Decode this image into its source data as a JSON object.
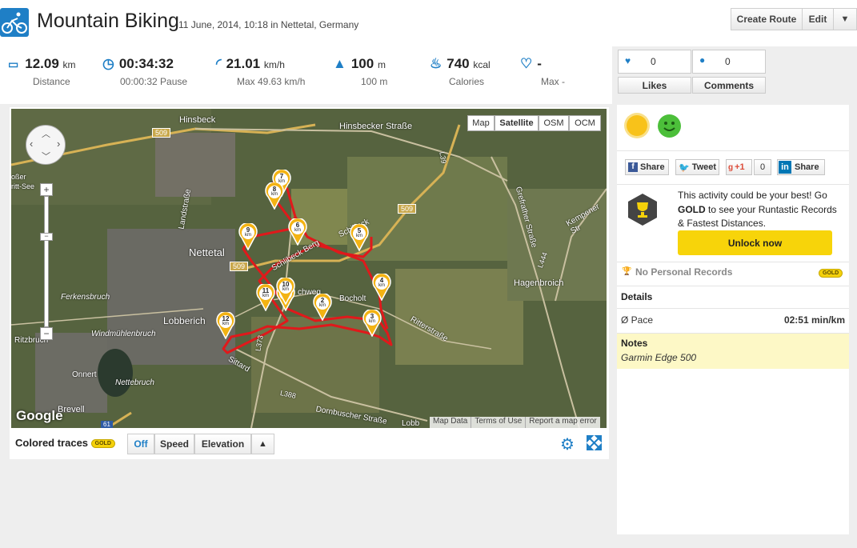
{
  "header": {
    "title": "Mountain Biking",
    "subtitle": "11 June, 2014, 10:18 in Nettetal, Germany",
    "create_route": "Create Route",
    "edit": "Edit"
  },
  "stats": [
    {
      "icon": "ruler-icon",
      "value": "12.09",
      "unit": "km",
      "sub": "Distance"
    },
    {
      "icon": "clock-icon",
      "value": "00:34:32",
      "unit": "",
      "sub": "00:00:32 Pause"
    },
    {
      "icon": "speedometer-icon",
      "value": "21.01",
      "unit": "km/h",
      "sub": "Max 49.63 km/h"
    },
    {
      "icon": "mountain-icon",
      "value": "100",
      "unit": "m",
      "sub": "100 m"
    },
    {
      "icon": "flame-icon",
      "value": "740",
      "unit": "kcal",
      "sub": "Calories"
    },
    {
      "icon": "heart-rate-icon",
      "value": "-",
      "unit": "",
      "sub": "Max -"
    }
  ],
  "social": {
    "likes_count": "0",
    "comments_count": "0",
    "likes_label": "Likes",
    "comments_label": "Comments"
  },
  "map": {
    "types": [
      "Map",
      "Satellite",
      "OSM",
      "OCM"
    ],
    "active_type": "Satellite",
    "labels": {
      "hinsbeck": "Hinsbeck",
      "hinsbecker_strasse": "Hinsbecker Straße",
      "nettetal": "Nettetal",
      "lobberich": "Lobberich",
      "ferkensbruch": "Ferkensbruch",
      "windmuehlenbruch": "Windmühlenbruch",
      "ritzbruch": "Ritzbruch",
      "onnert": "Onnert",
      "nettebruch": "Nettebruch",
      "brevell": "Brevell",
      "hagenbroich": "Hagenbroich",
      "landstrasse": "Landstraße",
      "schibeck": "Schibeck",
      "schlibeck": "Schlibeck Berg",
      "ritterstrasse": "Ritterstraße",
      "sittard": "Sittard",
      "dornbuscher": "Dornbuscher Straße",
      "grefrather": "Grefrather Straße",
      "kempener": "Kempener Str",
      "bocholt": "Bocholt",
      "chweg": "chweg",
      "l39": "L39",
      "l373": "L373",
      "l388": "L388",
      "l444": "L444",
      "road509": "509",
      "road61": "61",
      "obb": "Lobb",
      "grossen": "oßer",
      "witt": "ritt-See"
    },
    "markers": [
      "1",
      "2",
      "3",
      "4",
      "5",
      "6",
      "7",
      "8",
      "9",
      "10",
      "11",
      "12"
    ],
    "marker_unit": "km",
    "google": "Google",
    "attribution": [
      "Map Data",
      "Terms of Use",
      "Report a map error"
    ]
  },
  "map_footer": {
    "label": "Colored traces",
    "gold_badge": "GOLD",
    "modes": [
      "Off",
      "Speed",
      "Elevation"
    ],
    "active_mode": "Off"
  },
  "sidebar": {
    "share_facebook": "Share",
    "tweet": "Tweet",
    "gplus": "+1",
    "gplus_count": "0",
    "share_linkedin": "Share",
    "gold_text_1": "This activity could be your best! Go ",
    "gold_text_bold": "GOLD",
    "gold_text_2": " to see your Runtastic Records & Fastest Distances.",
    "unlock": "Unlock now",
    "no_records": "No Personal Records",
    "gold_badge": "GOLD",
    "details_title": "Details",
    "pace_label": "Ø Pace",
    "pace_value": "02:51 min/km",
    "notes_title": "Notes",
    "notes_value": "Garmin Edge 500"
  },
  "colors": {
    "accent_blue": "#1f7fc6",
    "route_red": "#e0191b",
    "gold": "#f5d10a",
    "notes_bg": "#fdf8c6"
  }
}
